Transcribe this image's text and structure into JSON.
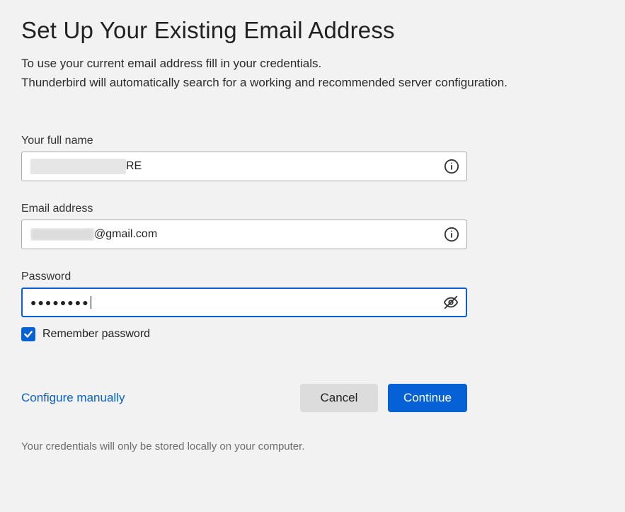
{
  "header": {
    "title": "Set Up Your Existing Email Address",
    "subtitle_line1": "To use your current email address fill in your credentials.",
    "subtitle_line2": "Thunderbird will automatically search for a working and recommended server configuration."
  },
  "fields": {
    "name": {
      "label": "Your full name",
      "visible_fragment": "RE"
    },
    "email": {
      "label": "Email address",
      "domain_part": "@gmail.com"
    },
    "password": {
      "label": "Password",
      "masked_value": "●●●●●●●●"
    }
  },
  "remember": {
    "label": "Remember password",
    "checked": true
  },
  "actions": {
    "configure_manually": "Configure manually",
    "cancel": "Cancel",
    "continue": "Continue"
  },
  "footer": {
    "note": "Your credentials will only be stored locally on your computer."
  },
  "colors": {
    "accent": "#0761d6",
    "bg": "#f2f2f2"
  }
}
